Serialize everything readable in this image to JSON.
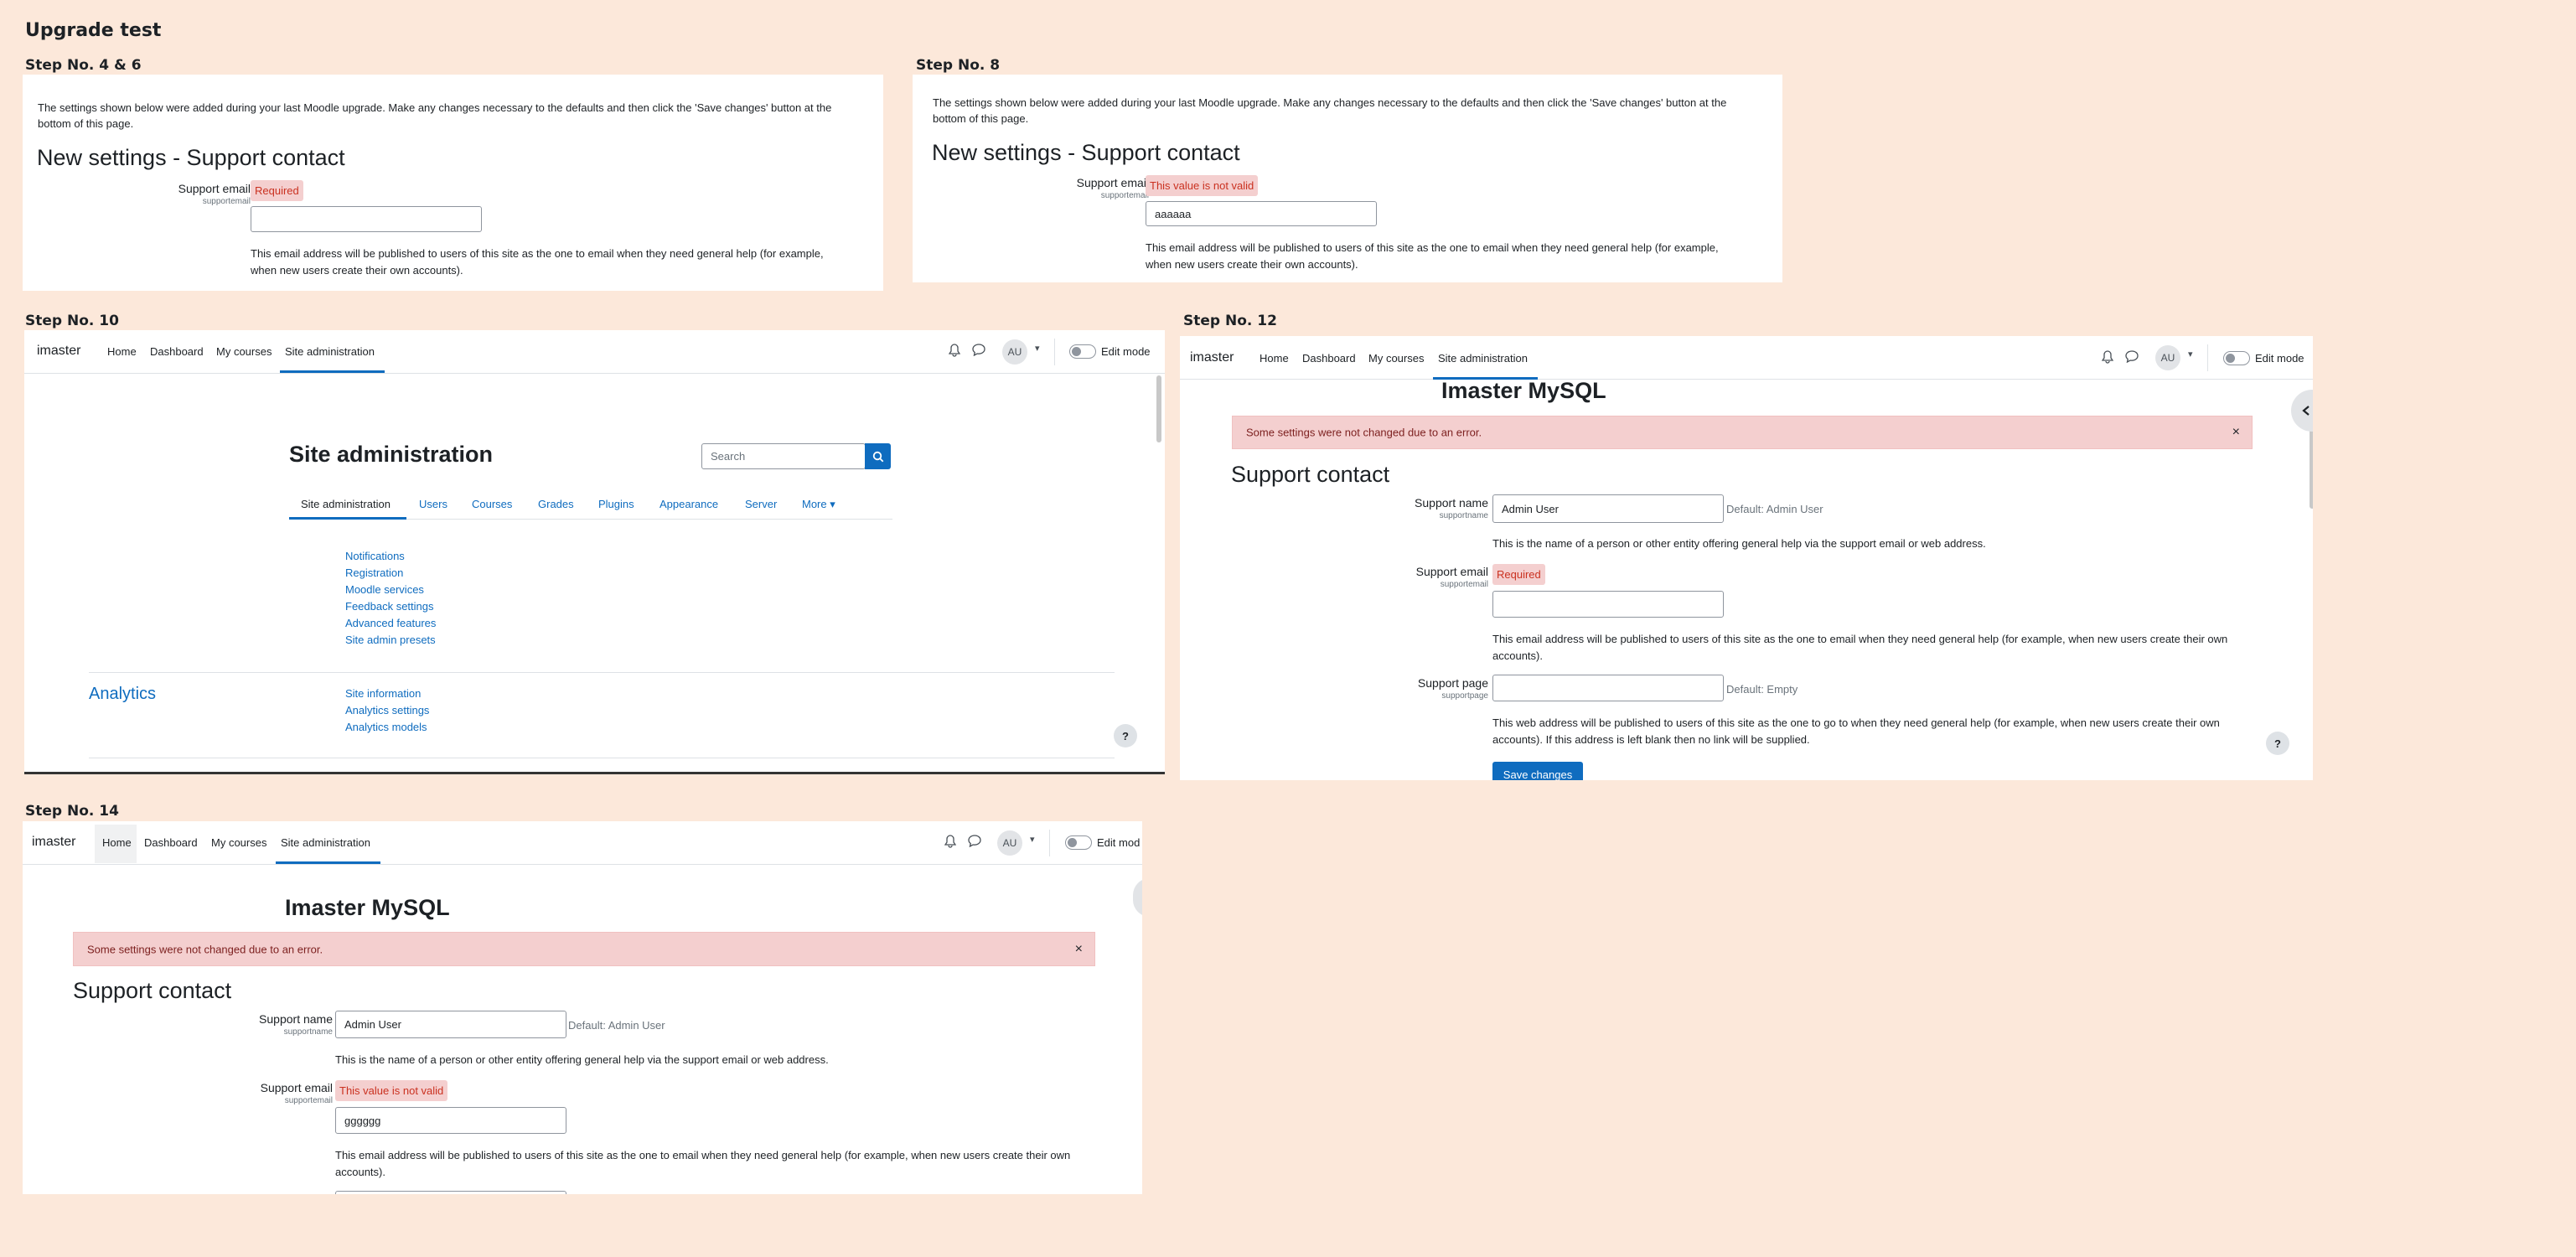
{
  "board_title": "Upgrade test",
  "steps": {
    "s46": "Step No. 4 & 6",
    "s8": "Step No. 8",
    "s10": "Step No. 10",
    "s12": "Step No. 12",
    "s14": "Step No. 14"
  },
  "common": {
    "intro_line1": "The settings shown below were added during your last Moodle upgrade. Make any changes necessary to the defaults and then click the 'Save changes' button at the",
    "intro_line2": "bottom of this page.",
    "new_settings_heading": "New settings - Support contact",
    "support_email_label": "Support email",
    "support_email_sub": "supportemail",
    "support_name_label": "Support name",
    "support_name_sub": "supportname",
    "support_page_label": "Support page",
    "support_page_sub": "supportpage",
    "email_desc1": "This email address will be published to users of this site as the one to email when they need general help (for example,",
    "email_desc2": "when new users create their own accounts).",
    "email_desc_wide1": "This email address will be published to users of this site as the one to email when they need general help (for example, when new users create their own",
    "email_desc_wide2": "accounts).",
    "name_desc": "This is the name of a person or other entity offering general help via the support email or web address.",
    "page_desc1": "This web address will be published to users of this site as the one to go to when they need general help (for example, when new users create their own",
    "page_desc2": "accounts). If this address is left blank then no link will be supplied.",
    "required": "Required",
    "not_valid": "This value is not valid",
    "default_admin": "Default: Admin User",
    "default_empty": "Default: Empty",
    "admin_user": "Admin User",
    "save_changes": "Save changes",
    "error_alert": "Some settings were not changed due to an error.",
    "close": "×",
    "site_heading": "Imaster MySQL",
    "support_contact": "Support contact"
  },
  "step8": {
    "email_value": "aaaaaa"
  },
  "step14": {
    "email_value": "gggggg"
  },
  "navbar": {
    "brand": "imaster",
    "home": "Home",
    "dashboard": "Dashboard",
    "my_courses": "My courses",
    "site_admin": "Site administration",
    "avatar": "AU",
    "edit_mode": "Edit mode",
    "edit_mode_cut": "Edit mod",
    "caret": "▾"
  },
  "step10": {
    "title": "Site administration",
    "search_placeholder": "Search",
    "tabs": [
      "Site administration",
      "Users",
      "Courses",
      "Grades",
      "Plugins",
      "Appearance",
      "Server",
      "More ▾"
    ],
    "general_links": [
      "Notifications",
      "Registration",
      "Moodle services",
      "Feedback settings",
      "Advanced features",
      "Site admin presets"
    ],
    "analytics_heading": "Analytics",
    "analytics_links": [
      "Site information",
      "Analytics settings",
      "Analytics models"
    ]
  },
  "colors": {
    "background": "#fce8da",
    "accent": "#0f6cbf",
    "error_bg": "#f4cfcf",
    "error_text": "#ca3120"
  },
  "icons": [
    "bell-icon",
    "chat-icon",
    "search-icon",
    "close-icon",
    "chevron-left-icon",
    "help-icon"
  ]
}
